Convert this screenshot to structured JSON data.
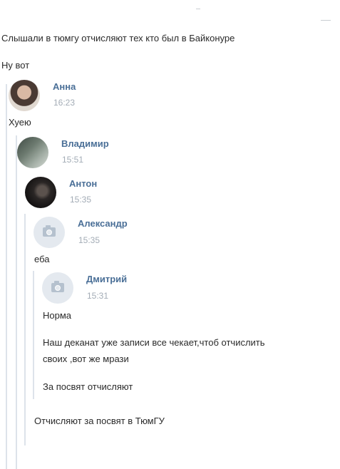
{
  "messages": {
    "top_line": "Слышали в тюмгу отчисляют тех кто был в Байконуре",
    "reply_1": "Ну вот"
  },
  "thread": [
    {
      "author": "Анна",
      "time": "16:23",
      "text": "Хуею",
      "avatar": "photo"
    },
    {
      "author": "Владимир",
      "time": "15:51",
      "text": "",
      "avatar": "photo"
    },
    {
      "author": "Антон",
      "time": "15:35",
      "text": "",
      "avatar": "photo"
    },
    {
      "author": "Александр",
      "time": "15:35",
      "text": "еба",
      "avatar": "camera-icon"
    },
    {
      "author": "Дмитрий",
      "time": "15:31",
      "avatar": "camera-icon",
      "lines": [
        "Норма",
        "Наш деканат уже записи все чекает,чтоб отчислить",
        "своих ,вот же мрази",
        "За посвят отчисляют"
      ]
    }
  ],
  "bottom_line": "Отчисляют за посвят в ТюмГУ"
}
